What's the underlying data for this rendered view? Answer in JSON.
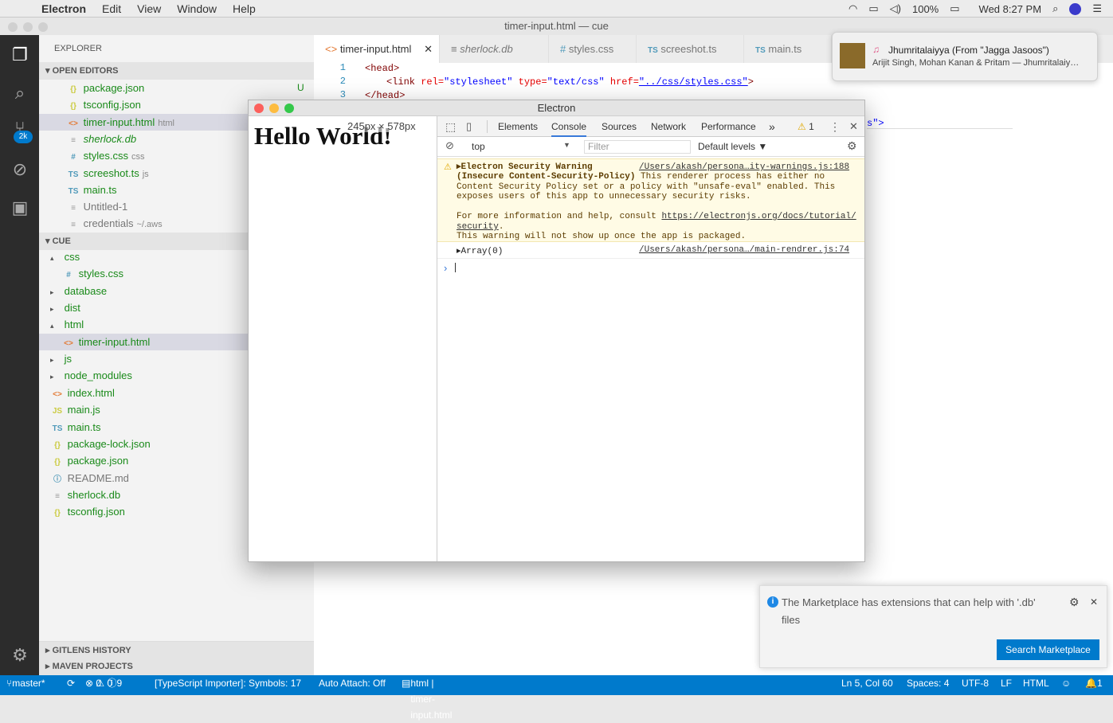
{
  "menubar": {
    "app": "Electron",
    "items": [
      "Edit",
      "View",
      "Window",
      "Help"
    ],
    "battery": "100%",
    "clock": "Wed 8:27 PM"
  },
  "window_title": "timer-input.html — cue",
  "activity": {
    "badge": "2k"
  },
  "sidebar": {
    "title": "EXPLORER",
    "open_editors_label": "OPEN EDITORS",
    "open_editors": [
      {
        "icon": "{}",
        "name": "package.json",
        "hint": "",
        "mark": "U"
      },
      {
        "icon": "{}",
        "name": "tsconfig.json",
        "hint": "",
        "mark": ""
      },
      {
        "icon": "<>",
        "name": "timer-input.html",
        "hint": "html",
        "mark": ""
      },
      {
        "icon": "≡",
        "name": "sherlock.db",
        "hint": "",
        "mark": ""
      },
      {
        "icon": "#",
        "name": "styles.css",
        "hint": "css",
        "mark": ""
      },
      {
        "icon": "TS",
        "name": "screeshot.ts",
        "hint": "js",
        "mark": ""
      },
      {
        "icon": "TS",
        "name": "main.ts",
        "hint": "",
        "mark": ""
      },
      {
        "icon": "≡",
        "name": "Untitled-1",
        "hint": "",
        "mark": ""
      },
      {
        "icon": "≡",
        "name": "credentials",
        "hint": "~/.aws",
        "mark": ""
      }
    ],
    "project_label": "CUE",
    "tree": [
      {
        "arrow": "▴",
        "icon": "",
        "name": "css"
      },
      {
        "arrow": "",
        "icon": "#",
        "name": "styles.css"
      },
      {
        "arrow": "▸",
        "icon": "",
        "name": "database"
      },
      {
        "arrow": "▸",
        "icon": "",
        "name": "dist"
      },
      {
        "arrow": "▴",
        "icon": "",
        "name": "html"
      },
      {
        "arrow": "",
        "icon": "<>",
        "name": "timer-input.html"
      },
      {
        "arrow": "▸",
        "icon": "",
        "name": "js"
      },
      {
        "arrow": "▸",
        "icon": "",
        "name": "node_modules"
      },
      {
        "arrow": "",
        "icon": "<>",
        "name": "index.html"
      },
      {
        "arrow": "",
        "icon": "JS",
        "name": "main.js"
      },
      {
        "arrow": "",
        "icon": "TS",
        "name": "main.ts"
      },
      {
        "arrow": "",
        "icon": "{}",
        "name": "package-lock.json"
      },
      {
        "arrow": "",
        "icon": "{}",
        "name": "package.json"
      },
      {
        "arrow": "",
        "icon": "ⓘ",
        "name": "README.md"
      },
      {
        "arrow": "",
        "icon": "≡",
        "name": "sherlock.db"
      },
      {
        "arrow": "",
        "icon": "{}",
        "name": "tsconfig.json"
      }
    ],
    "gitlens": "GITLENS HISTORY",
    "maven": "MAVEN PROJECTS"
  },
  "editor": {
    "tabs": [
      {
        "icon": "<>",
        "label": "timer-input.html",
        "close": "✕"
      },
      {
        "icon": "≡",
        "label": "sherlock.db"
      },
      {
        "icon": "#",
        "label": "styles.css"
      },
      {
        "icon": "TS",
        "label": "screeshot.ts"
      },
      {
        "icon": "TS",
        "label": "main.ts"
      }
    ],
    "lines": {
      "n1": "1",
      "n2": "2",
      "n3": "3",
      "l1": "<head>",
      "l2_tag": "<link ",
      "l2_a1": "rel=",
      "l2_s1": "\"stylesheet\"",
      "l2_a2": " type=",
      "l2_s2": "\"text/css\"",
      "l2_a3": " href=",
      "l2_s3": "\"../css/styles.css\"",
      "l2_end": ">",
      "l3": "</head>",
      "frag": "s\">"
    }
  },
  "electron": {
    "title": "Electron",
    "hello": "Hello World!",
    "dims": "245px × 578px",
    "devtools": {
      "tabs": [
        "Elements",
        "Console",
        "Sources",
        "Network",
        "Performance"
      ],
      "more": "»",
      "warn_count": "1",
      "context": "top",
      "filter_placeholder": "Filter",
      "levels": "Default levels ▼",
      "warn_title": "Electron Security Warning",
      "warn_link": "/Users/akash/persona…ity-warnings.js:188",
      "warn_l2a": "(Insecure Content-Security-Policy)",
      "warn_l2b": " This renderer process has either no",
      "warn_l3": "Content Security Policy set or a policy with \"unsafe-eval\" enabled. This",
      "warn_l4": "exposes users of this app to unnecessary security risks.",
      "warn_l5a": "For more information and help, consult ",
      "warn_l5b": "https://electronjs.org/docs/tutorial/",
      "warn_l6a": "security",
      "warn_l6b": ".",
      "warn_l7": "This warning will not show up once the app is packaged.",
      "array": "Array(0)",
      "array_link": "/Users/akash/persona…/main-rendrer.js:74",
      "prompt": "›"
    }
  },
  "notification": {
    "title": "Jhumritalaiyya (From \"Jagga Jasoos\")",
    "subtitle": "Arijit Singh, Mohan Kanan & Pritam — Jhumritalaiy…"
  },
  "marketplace": {
    "text1": "The Marketplace has extensions that can help with '.db'",
    "text2": "files",
    "button": "Search Marketplace"
  },
  "status": {
    "branch": "master*",
    "errors": "0",
    "warnings": "0",
    "info": "9",
    "ts": "[TypeScript Importer]: Symbols: 17",
    "attach": "Auto Attach: Off",
    "lang_file": "html | timer-input.html",
    "pos": "Ln 5, Col 60",
    "spaces": "Spaces: 4",
    "enc": "UTF-8",
    "eol": "LF",
    "lang": "HTML",
    "bell": "1"
  }
}
